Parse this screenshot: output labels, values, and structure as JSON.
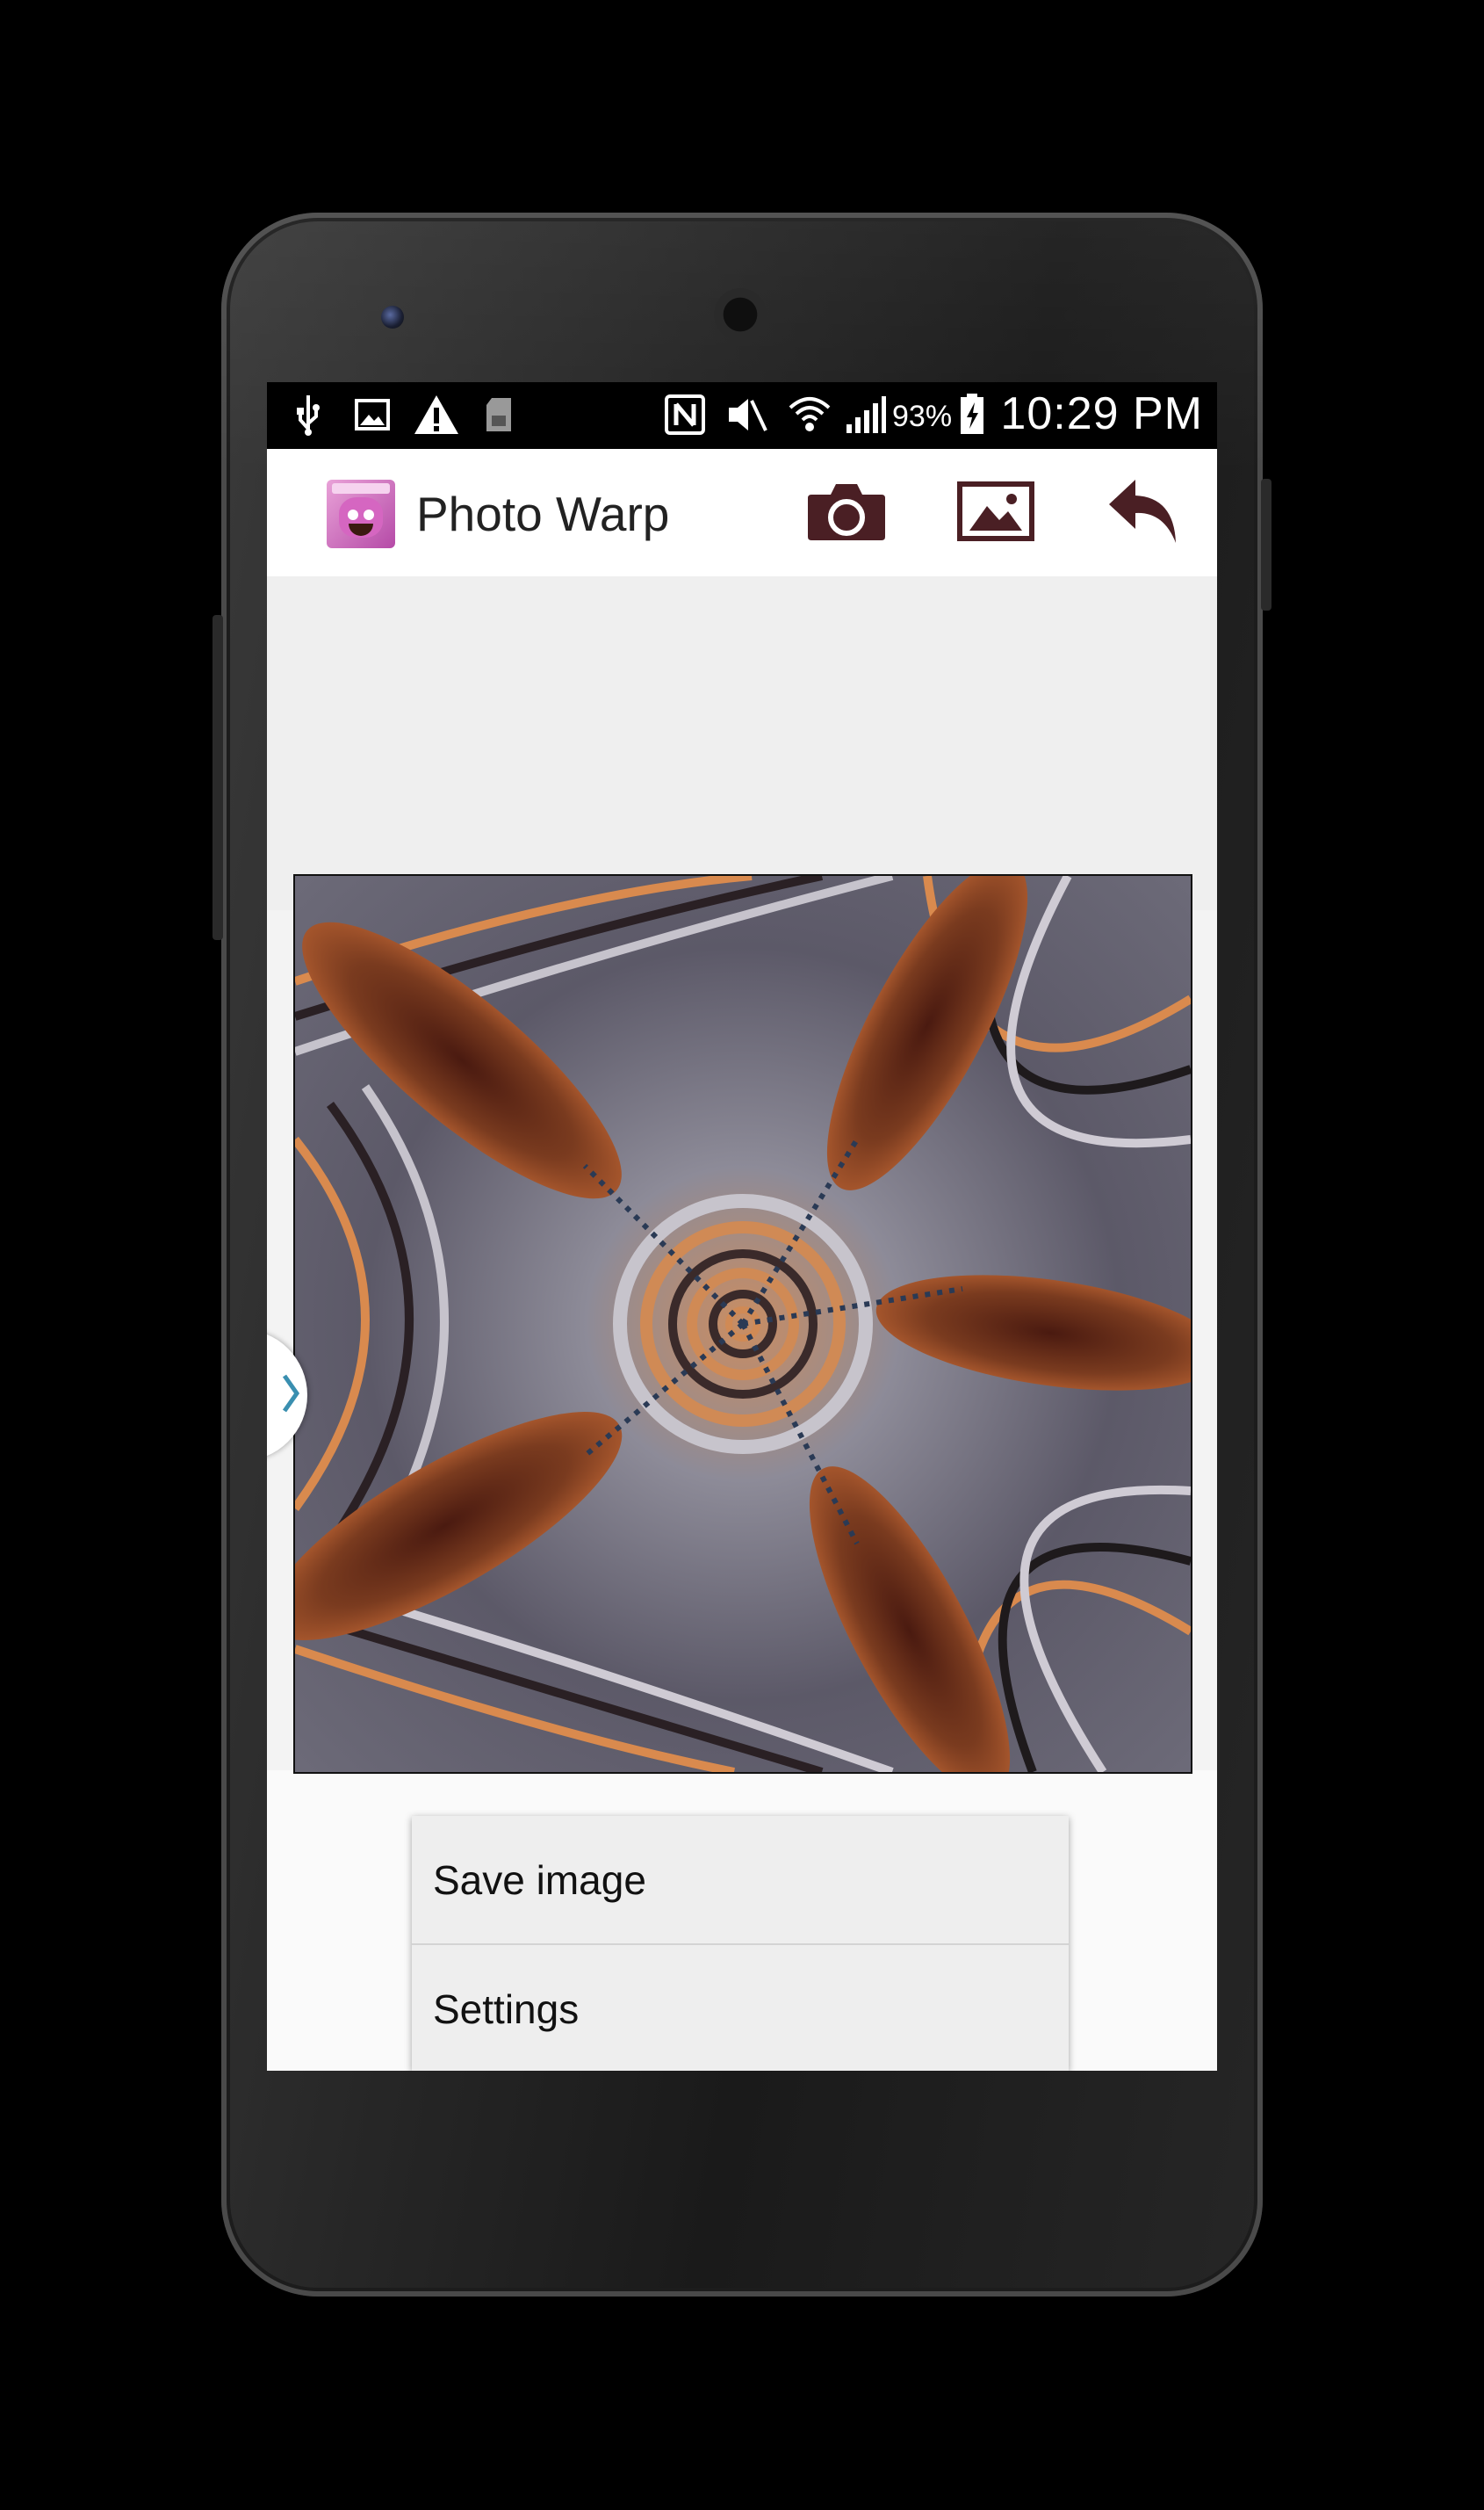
{
  "status_bar": {
    "icons": [
      "usb-icon",
      "image-notification-icon",
      "warning-icon",
      "sd-card-icon",
      "nfc-icon",
      "mute-icon",
      "wifi-icon",
      "signal-icon",
      "battery-charging-icon"
    ],
    "battery_percent": "93%",
    "time": "10:29 PM"
  },
  "app_bar": {
    "title": "Photo Warp",
    "actions": [
      "camera-icon",
      "gallery-icon",
      "undo-icon"
    ],
    "accent_color": "#4a1f24"
  },
  "image": {
    "description_icon": "warped-photo-icon"
  },
  "overflow_menu": {
    "items": [
      {
        "label": "Save image"
      },
      {
        "label": "Settings"
      }
    ]
  }
}
